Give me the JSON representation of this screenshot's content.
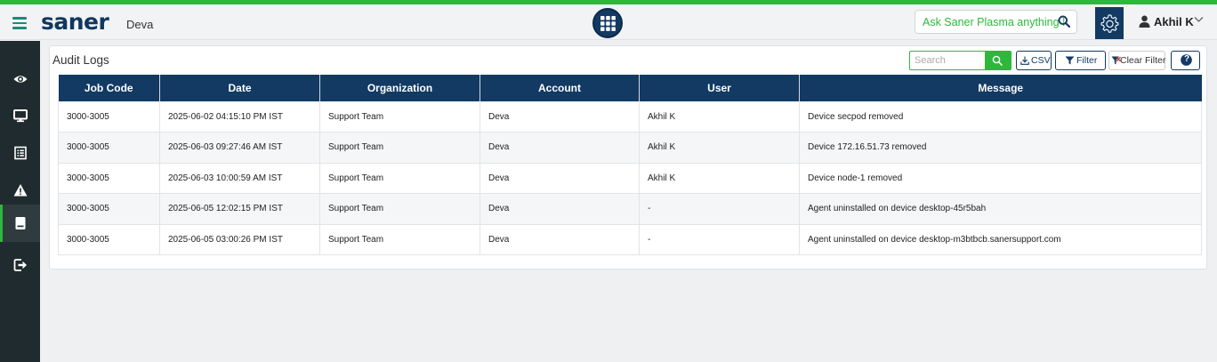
{
  "header": {
    "logo": "saner",
    "account_name": "Deva",
    "ask_placeholder": "Ask Saner Plasma anything !",
    "user_name": "Akhil K"
  },
  "sidebar": {
    "items": [
      {
        "icon": "eye-icon"
      },
      {
        "icon": "monitor-icon"
      },
      {
        "icon": "list-icon"
      },
      {
        "icon": "warning-icon"
      },
      {
        "icon": "logs-icon",
        "active": true
      },
      {
        "icon": "logout-icon"
      }
    ]
  },
  "panel": {
    "title": "Audit Logs",
    "search_placeholder": "Search",
    "csv_label": "CSV",
    "filter_label": "Filter",
    "clear_filter_label": "Clear Filter",
    "help_label": "?"
  },
  "table": {
    "columns": [
      "Job Code",
      "Date",
      "Organization",
      "Account",
      "User",
      "Message"
    ],
    "rows": [
      [
        "3000-3005",
        "2025-06-02 04:15:10 PM IST",
        "Support Team",
        "Deva",
        "Akhil K",
        "Device secpod removed"
      ],
      [
        "3000-3005",
        "2025-06-03 09:27:46 AM IST",
        "Support Team",
        "Deva",
        "Akhil K",
        "Device 172.16.51.73 removed"
      ],
      [
        "3000-3005",
        "2025-06-03 10:00:59 AM IST",
        "Support Team",
        "Deva",
        "Akhil K",
        "Device node-1 removed"
      ],
      [
        "3000-3005",
        "2025-06-05 12:02:15 PM IST",
        "Support Team",
        "Deva",
        "-",
        "Agent uninstalled on device desktop-45r5bah"
      ],
      [
        "3000-3005",
        "2025-06-05 03:00:26 PM IST",
        "Support Team",
        "Deva",
        "-",
        "Agent uninstalled on device desktop-m3btbcb.sanersupport.com"
      ]
    ]
  },
  "colors": {
    "accent_green": "#2db83d",
    "navy": "#123a63",
    "sidebar_bg": "#1f2b2e"
  }
}
